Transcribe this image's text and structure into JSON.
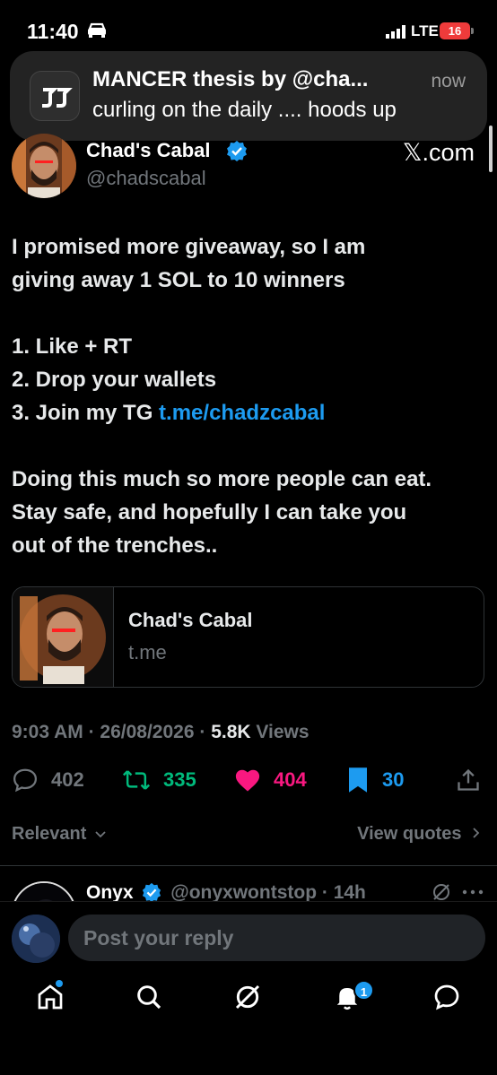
{
  "status_bar": {
    "time": "11:40",
    "network": "LTE",
    "battery": "16"
  },
  "notification": {
    "title": "MANCER thesis by @cha...",
    "time": "now",
    "body": "curling on the daily .... hoods up"
  },
  "tweet": {
    "author_name": "Chad's Cabal",
    "handle": "@chadscabal",
    "source": "𝕏.com",
    "paragraph1_line1": "I promised more giveaway, so I am",
    "paragraph1_line2": "giving away 1 SOL to 10 winners",
    "step1": "1. Like + RT",
    "step2": "2. Drop your wallets",
    "step3_prefix": "3. Join my TG ",
    "step3_link": "t.me/chadzcabal",
    "paragraph3_line1": "Doing this much so more people can eat.",
    "paragraph3_line2": "Stay safe, and hopefully I can take you",
    "paragraph3_line3": "out of the trenches.."
  },
  "link_card": {
    "title": "Chad's Cabal",
    "domain": "t.me"
  },
  "meta": {
    "time": "9:03 AM",
    "sep1": " · ",
    "date": "26/08/2026",
    "sep2": " · ",
    "views_count": "5.8K",
    "views_label": " Views"
  },
  "actions": {
    "replies": "402",
    "retweets": "335",
    "likes": "404",
    "bookmarks": "30"
  },
  "colors": {
    "reply": "#71767b",
    "retweet": "#00ba7c",
    "like": "#f91880",
    "bookmark": "#1d9bf0"
  },
  "sort": {
    "label": "Relevant",
    "view_quotes": "View quotes"
  },
  "reply_preview": {
    "name": "Onyx",
    "handle": "@onyxwontstop",
    "sep": " · ",
    "time": "14h"
  },
  "composer": {
    "placeholder": "Post your reply"
  },
  "nav": {
    "notifications_badge": "1"
  }
}
